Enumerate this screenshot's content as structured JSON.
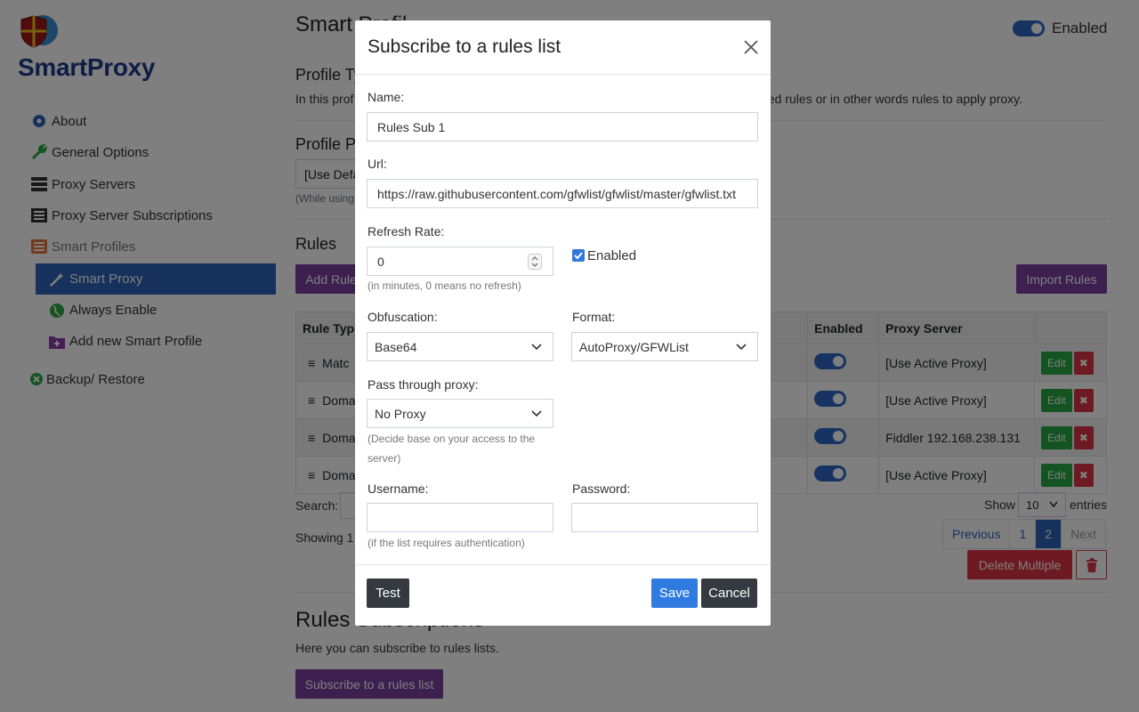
{
  "brand": {
    "name": "SmartProxy"
  },
  "sidebar": {
    "items": [
      {
        "label": "About",
        "icon": "gear-icon"
      },
      {
        "label": "General Options",
        "icon": "wrench-icon"
      },
      {
        "label": "Proxy Servers",
        "icon": "server-icon"
      },
      {
        "label": "Proxy Server Subscriptions",
        "icon": "list-icon"
      },
      {
        "label": "Smart Profiles",
        "icon": "list-icon"
      },
      {
        "label": "Smart Proxy",
        "icon": "magic-wand-icon"
      },
      {
        "label": "Always Enable",
        "icon": "globe-icon"
      },
      {
        "label": "Add new Smart Profile",
        "icon": "folder-plus-icon"
      },
      {
        "label": "Backup/ Restore",
        "icon": "close-circle-icon"
      }
    ]
  },
  "page": {
    "title": "Smart Profil",
    "enabled_label": "Enabled",
    "profile_type_heading": "Profile Ty",
    "profile_type_desc_left": "In this prof",
    "profile_type_desc_right": "sted rules or in other words rules to apply proxy.",
    "profile_proxy_heading": "Profile Pr",
    "profile_proxy_select": "[Use Defa",
    "profile_proxy_hint": "(While using",
    "rules_heading": "Rules",
    "add_rule_button": "Add Rule",
    "import_rules_button": "Import Rules",
    "table": {
      "headers": [
        "Rule Type",
        "Enabled",
        "Proxy Server"
      ],
      "rows": [
        {
          "type": "Matc",
          "proxy": "[Use Active Proxy]"
        },
        {
          "type": "Doma",
          "proxy": "[Use Active Proxy]"
        },
        {
          "type": "Doma",
          "proxy": "Fiddler 192.168.238.131"
        },
        {
          "type": "Doma",
          "proxy": "[Use Active Proxy]"
        }
      ],
      "edit_label": "Edit",
      "delete_label": "✖"
    },
    "search_label": "Search:",
    "show_label": "Show",
    "show_value": "10",
    "entries_label": "entries",
    "showing_text": "Showing 1",
    "pagination": {
      "previous": "Previous",
      "page1": "1",
      "page2": "2",
      "next": "Next"
    },
    "delete_multiple": "Delete Multiple",
    "subscriptions_heading": "Rules Subscriptions",
    "subscriptions_desc": "Here you can subscribe to rules lists.",
    "subscribe_button": "Subscribe to a rules list"
  },
  "modal": {
    "title": "Subscribe to a rules list",
    "name_label": "Name:",
    "name_value": "Rules Sub 1",
    "url_label": "Url:",
    "url_value": "https://raw.githubusercontent.com/gfwlist/gfwlist/master/gfwlist.txt",
    "refresh_label": "Refresh Rate:",
    "refresh_value": "0",
    "refresh_hint": "(in minutes, 0 means no refresh)",
    "enabled_label": "Enabled",
    "obfuscation_label": "Obfuscation:",
    "obfuscation_value": "Base64",
    "format_label": "Format:",
    "format_value": "AutoProxy/GFWList",
    "pass_label": "Pass through proxy:",
    "pass_value": "No Proxy",
    "pass_hint": "(Decide base on your access to the server)",
    "username_label": "Username:",
    "username_value": "",
    "password_label": "Password:",
    "password_value": "",
    "auth_hint": "(if the list requires authentication)",
    "test_button": "Test",
    "save_button": "Save",
    "cancel_button": "Cancel"
  },
  "colors": {
    "accent_blue": "#2b63b8",
    "purple": "#7a3ea0",
    "green": "#28a745",
    "red": "#dc3545",
    "dark_button": "#343a40"
  }
}
